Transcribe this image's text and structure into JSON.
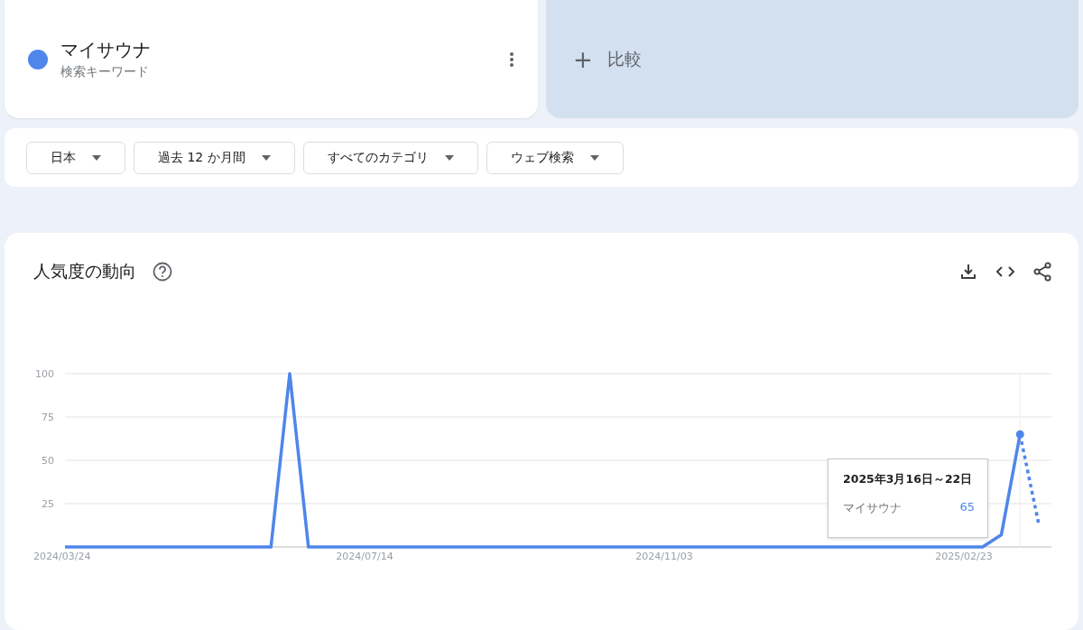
{
  "keyword": {
    "name": "マイサウナ",
    "type": "検索キーワード",
    "color": "#4f86ea"
  },
  "compare": {
    "icon": "+",
    "label": "比較"
  },
  "filters": [
    {
      "label": "日本"
    },
    {
      "label": "過去 12 か月間"
    },
    {
      "label": "すべてのカテゴリ"
    },
    {
      "label": "ウェブ検索"
    }
  ],
  "trend": {
    "title": "人気度の動向",
    "chart_data": {
      "type": "line",
      "grid": true,
      "ylim": [
        0,
        100
      ],
      "yticks": [
        25,
        50,
        75,
        100
      ],
      "categories": [
        "2024/03/24",
        null,
        null,
        null,
        null,
        null,
        null,
        null,
        null,
        null,
        null,
        null,
        null,
        null,
        null,
        null,
        "2024/07/14",
        null,
        null,
        null,
        null,
        null,
        null,
        null,
        null,
        null,
        null,
        null,
        null,
        null,
        null,
        null,
        "2024/11/03",
        null,
        null,
        null,
        null,
        null,
        null,
        null,
        null,
        null,
        null,
        null,
        null,
        null,
        null,
        null,
        "2025/02/23",
        null,
        null,
        null,
        null
      ],
      "series": [
        {
          "name": "マイサウナ",
          "color": "#4f86ea",
          "values": [
            0,
            0,
            0,
            0,
            0,
            0,
            0,
            0,
            0,
            0,
            0,
            0,
            100,
            0,
            0,
            0,
            0,
            0,
            0,
            0,
            0,
            0,
            0,
            0,
            0,
            0,
            0,
            0,
            0,
            0,
            0,
            0,
            0,
            0,
            0,
            0,
            0,
            0,
            0,
            0,
            0,
            0,
            0,
            0,
            0,
            0,
            0,
            0,
            0,
            0,
            7,
            65,
            13
          ]
        }
      ]
    },
    "tooltip": {
      "date": "2025年3月16日～22日",
      "value": "65"
    }
  }
}
